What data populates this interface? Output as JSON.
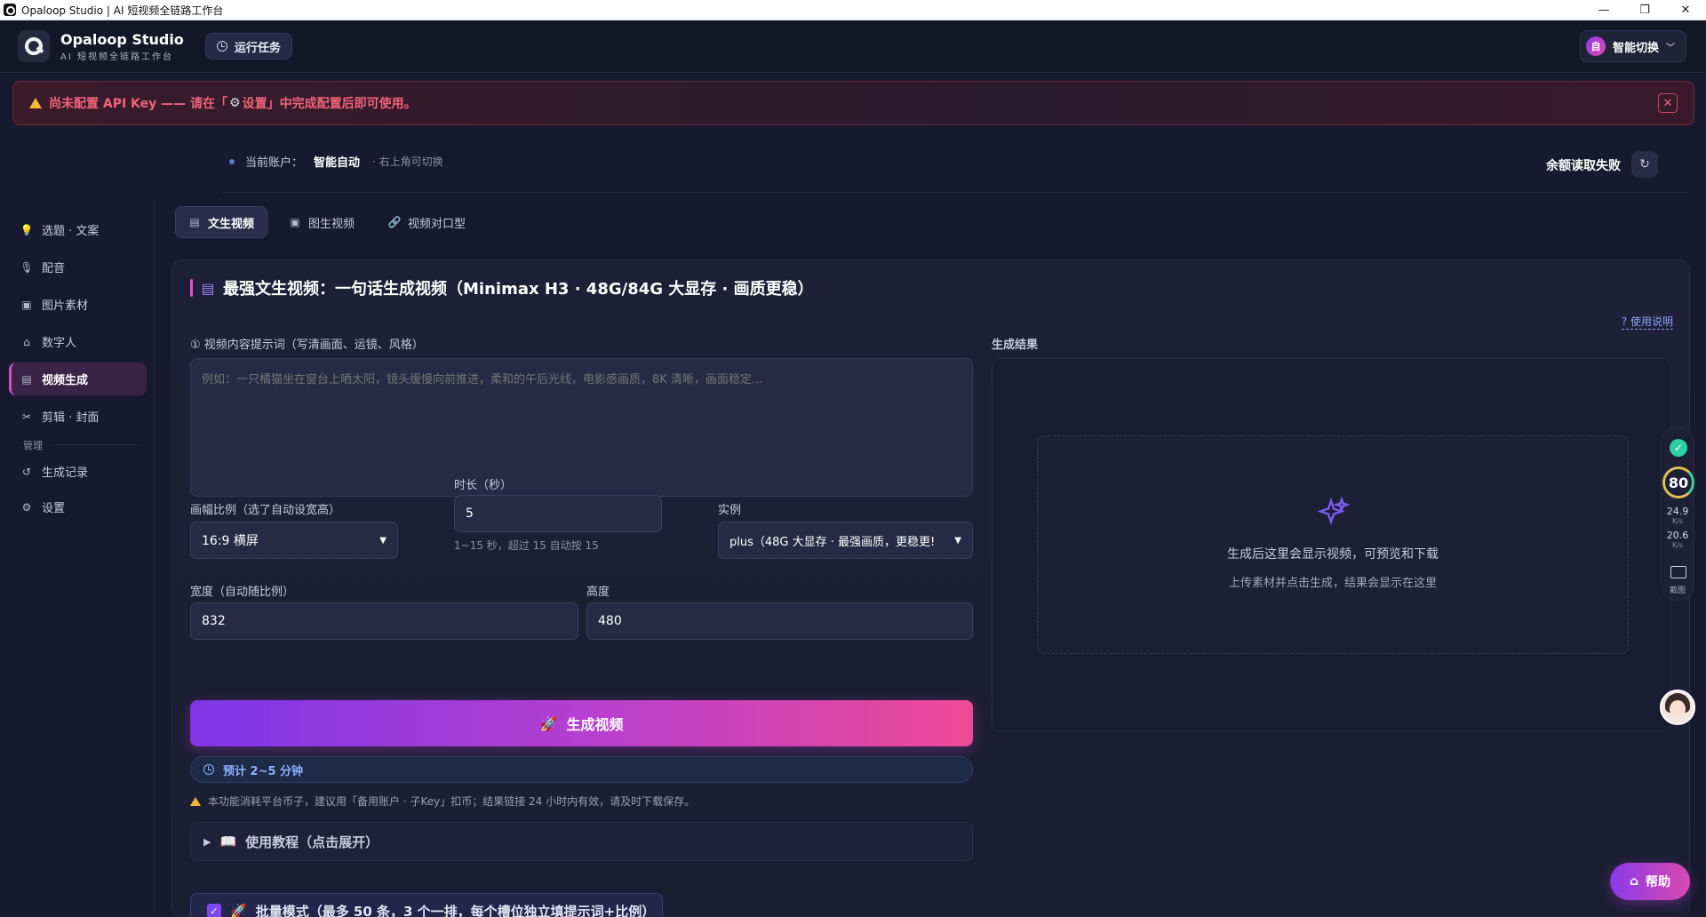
{
  "window": {
    "title": "Opaloop Studio | AI 短视频全链路工作台",
    "controls": [
      "—",
      "❐",
      "✕"
    ]
  },
  "header": {
    "brand_name": "Opaloop Studio",
    "brand_sub": "AI 短视频全链路工作台",
    "run_tasks": "运行任务",
    "account_switch_badge": "自",
    "account_switch": "智能切换"
  },
  "banner": {
    "text_before": "尚未配置 API Key —— 请在「",
    "settings_word": "设置",
    "text_after": "」中完成配置后即可使用。",
    "close": "✕"
  },
  "account": {
    "label": "当前账户：",
    "value": "智能自动",
    "hint": "· 右上角可切换",
    "balance": "余额读取失败"
  },
  "sidebar": {
    "items": [
      {
        "label": "选题 · 文案",
        "icon": "lightbulb-icon"
      },
      {
        "label": "配音",
        "icon": "mic-icon"
      },
      {
        "label": "图片素材",
        "icon": "image-icon"
      },
      {
        "label": "数字人",
        "icon": "robot-icon"
      },
      {
        "label": "视频生成",
        "icon": "clapper-icon",
        "active": true
      },
      {
        "label": "剪辑 · 封面",
        "icon": "scissors-icon"
      }
    ],
    "section_label": "管理",
    "manage_items": [
      {
        "label": "生成记录",
        "icon": "history-icon"
      },
      {
        "label": "设置",
        "icon": "gear-icon"
      }
    ]
  },
  "tabs": [
    {
      "label": "文生视频",
      "active": true
    },
    {
      "label": "图生视频"
    },
    {
      "label": "视频对口型"
    }
  ],
  "main": {
    "title": "最强文生视频：一句话生成视频（Minimax H3 · 48G/84G 大显存 · 画质更稳）",
    "help_link": "? 使用说明",
    "prompt_label": "① 视频内容提示词（写清画面、运镜、风格）",
    "prompt_placeholder": "例如：一只橘猫坐在窗台上晒太阳，镜头缓慢向前推进，柔和的午后光线，电影感画质，8K 清晰，画面稳定...",
    "aspect_label": "画幅比例（选了自动设宽高）",
    "aspect_value": "16:9 横屏",
    "duration_label": "时长（秒）",
    "duration_value": "5",
    "duration_hint": "1~15 秒，超过 15 自动按 15",
    "instance_label": "实例",
    "instance_value": "plus（48G 大显存 · 最强画质，更稳更!",
    "width_label": "宽度（自动随比例）",
    "width_value": "832",
    "height_label": "高度",
    "height_value": "480",
    "generate_button": "生成视频",
    "estimate": "预计 2~5 分钟",
    "notice": "本功能消耗平台币子，建议用「备用账户 · 子Key」扣币；结果链接 24 小时内有效，请及时下载保存。",
    "tutorial": "使用教程（点击展开）",
    "batch_mode": "批量模式（最多 50 条，3 个一排，每个槽位独立填提示词+比例）"
  },
  "result": {
    "label": "生成结果",
    "title": "生成后这里会显示视频，可预览和下载",
    "subtitle": "上传素材并点击生成，结果会显示在这里"
  },
  "widget": {
    "score": "80",
    "up_speed": "24.9",
    "up_unit": "K/s",
    "down_speed": "20.6",
    "down_unit": "K/s",
    "screenshot": "截图"
  },
  "help_button": "帮助",
  "colors": {
    "accent_pink": "#e150c8",
    "accent_purple": "#7d36e8",
    "warning_red": "#f0647a",
    "bg": "#171a2e"
  }
}
